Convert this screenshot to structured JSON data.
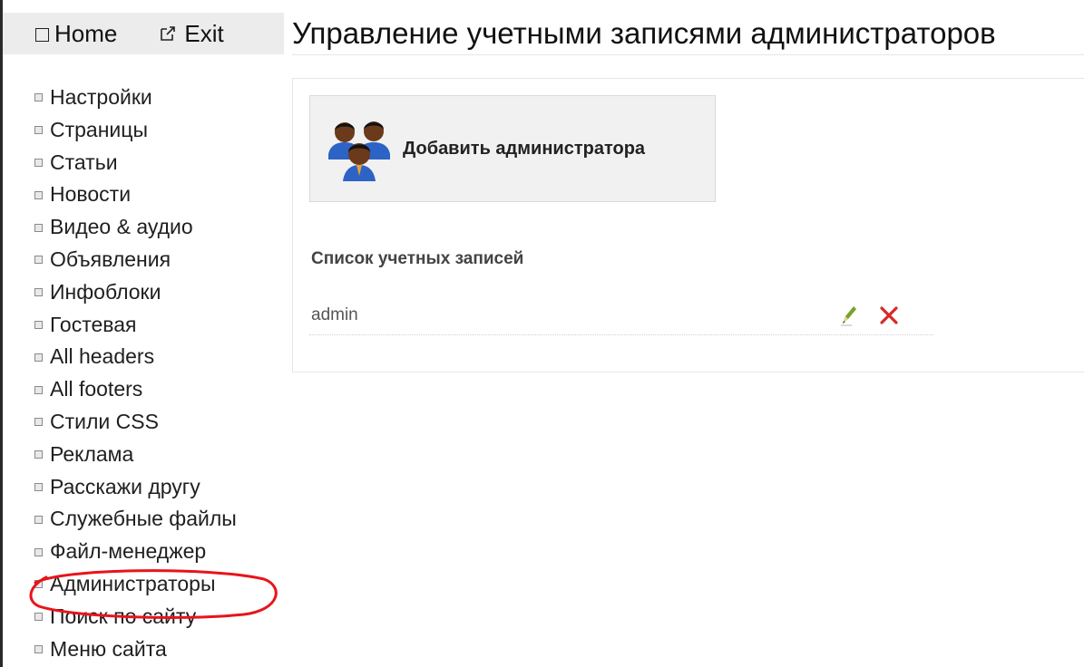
{
  "nav": {
    "home_label": "Home",
    "exit_label": "Exit"
  },
  "page": {
    "title": "Управление учетными записями администраторов"
  },
  "sidebar": {
    "items": [
      {
        "label": "Настройки"
      },
      {
        "label": "Страницы"
      },
      {
        "label": "Статьи"
      },
      {
        "label": "Новости"
      },
      {
        "label": "Видео & аудио"
      },
      {
        "label": "Объявления"
      },
      {
        "label": "Инфоблоки"
      },
      {
        "label": "Гостевая"
      },
      {
        "label": "All headers"
      },
      {
        "label": "All footers"
      },
      {
        "label": "Стили CSS"
      },
      {
        "label": "Реклама"
      },
      {
        "label": "Расскажи другу"
      },
      {
        "label": "Служебные файлы"
      },
      {
        "label": "Файл-менеджер"
      },
      {
        "label": "Администраторы",
        "highlighted": true
      },
      {
        "label": "Поиск по сайту"
      },
      {
        "label": "Меню сайта"
      }
    ]
  },
  "main": {
    "add_button_label": "Добавить администратора",
    "add_button_icon": "admins-group-icon",
    "accounts_heading": "Список учетных записей",
    "accounts": [
      {
        "name": "admin",
        "actions": [
          "edit-icon",
          "delete-icon"
        ]
      }
    ]
  },
  "colors": {
    "highlight_ellipse": "#e8141a",
    "delete_icon": "#d42a2a",
    "edit_icon": "#7aa12a"
  }
}
